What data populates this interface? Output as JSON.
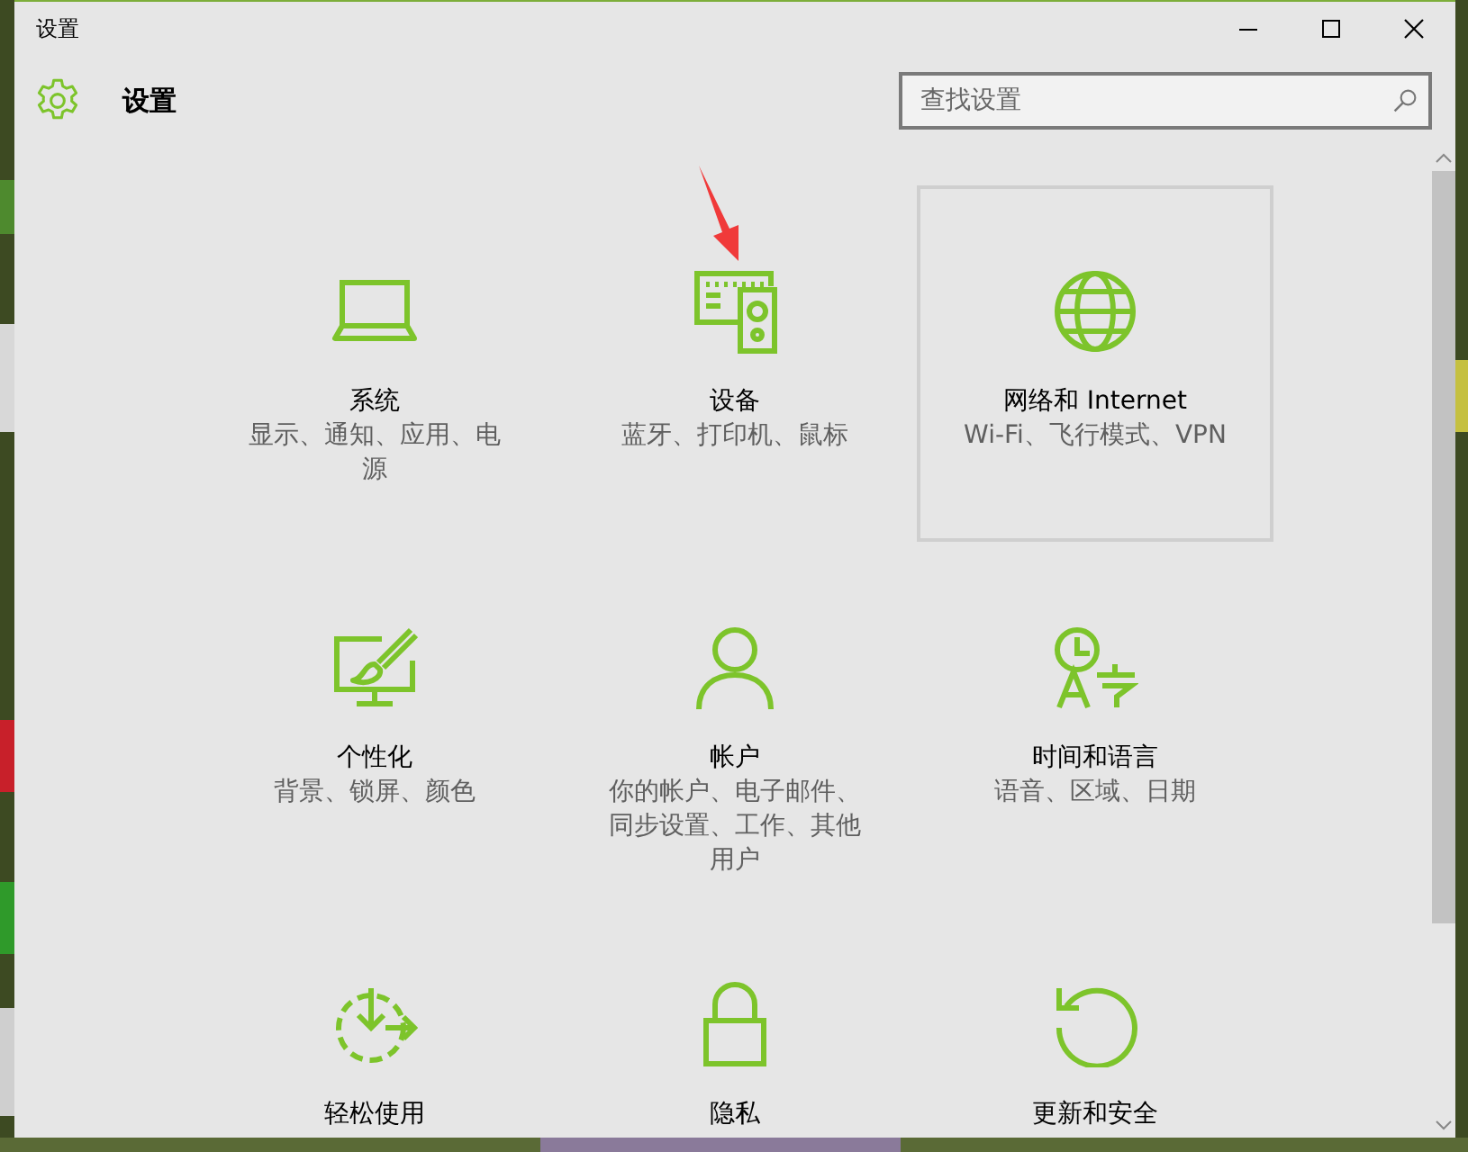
{
  "window": {
    "title": "设置"
  },
  "header": {
    "title": "设置"
  },
  "search": {
    "placeholder": "查找设置"
  },
  "categories": [
    {
      "title": "系统",
      "description": "显示、通知、应用、电源",
      "selected": false
    },
    {
      "title": "设备",
      "description": "蓝牙、打印机、鼠标",
      "selected": false
    },
    {
      "title": "网络和 Internet",
      "description": "Wi-Fi、飞行模式、VPN",
      "selected": true
    },
    {
      "title": "个性化",
      "description": "背景、锁屏、颜色",
      "selected": false
    },
    {
      "title": "帐户",
      "description": "你的帐户、电子邮件、同步设置、工作、其他用户",
      "selected": false
    },
    {
      "title": "时间和语言",
      "description": "语音、区域、日期",
      "selected": false
    },
    {
      "title": "轻松使用",
      "selected": false
    },
    {
      "title": "隐私",
      "selected": false
    },
    {
      "title": "更新和安全",
      "selected": false
    }
  ]
}
